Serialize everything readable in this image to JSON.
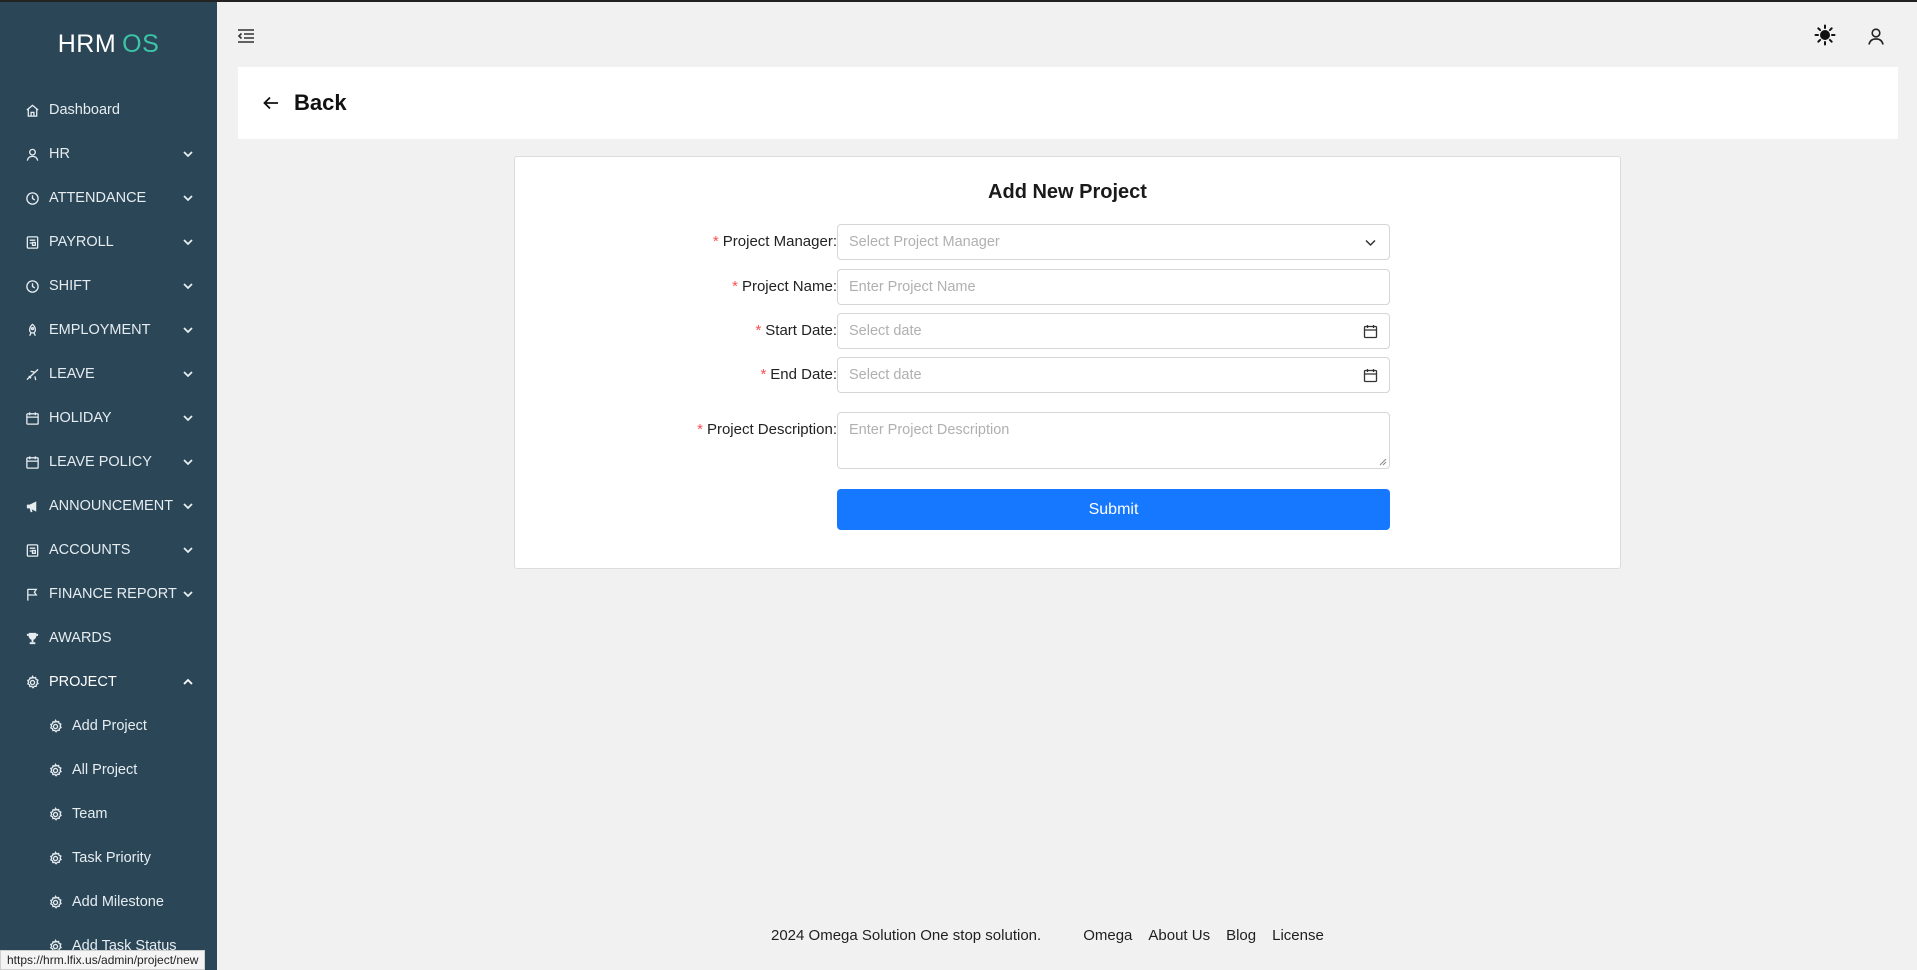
{
  "brand": {
    "name": "HRM",
    "accent": "OS",
    "accent_color": "#3cc4a6"
  },
  "sidebar": {
    "items": [
      {
        "label": "Dashboard",
        "icon": "home-icon"
      },
      {
        "label": "HR",
        "icon": "user-icon"
      },
      {
        "label": "ATTENDANCE",
        "icon": "clock-icon"
      },
      {
        "label": "PAYROLL",
        "icon": "file-icon"
      },
      {
        "label": "SHIFT",
        "icon": "clock-icon"
      },
      {
        "label": "EMPLOYMENT",
        "icon": "rocket-icon"
      },
      {
        "label": "LEAVE",
        "icon": "plane-icon"
      },
      {
        "label": "HOLIDAY",
        "icon": "calendar-icon"
      },
      {
        "label": "LEAVE POLICY",
        "icon": "calendar-icon"
      },
      {
        "label": "ANNOUNCEMENT",
        "icon": "megaphone-icon"
      },
      {
        "label": "ACCOUNTS",
        "icon": "file-icon"
      },
      {
        "label": "FINANCE REPORT",
        "icon": "flag-icon"
      },
      {
        "label": "AWARDS",
        "icon": "trophy-icon"
      },
      {
        "label": "PROJECT",
        "icon": "gear-icon"
      }
    ],
    "project_sub": [
      {
        "label": "Add Project"
      },
      {
        "label": "All Project"
      },
      {
        "label": "Team"
      },
      {
        "label": "Task Priority"
      },
      {
        "label": "Add Milestone"
      },
      {
        "label": "Add Task Status"
      }
    ]
  },
  "header": {
    "back_label": "Back"
  },
  "form": {
    "title": "Add New Project",
    "fields": {
      "manager": {
        "label": "Project Manager",
        "placeholder": "Select Project Manager"
      },
      "name": {
        "label": "Project Name",
        "placeholder": "Enter Project Name"
      },
      "start": {
        "label": "Start Date",
        "placeholder": "Select date"
      },
      "end": {
        "label": "End Date",
        "placeholder": "Select date"
      },
      "description": {
        "label": "Project Description",
        "placeholder": "Enter Project Description"
      }
    },
    "required_mark": "*",
    "colon": ":",
    "submit_label": "Submit"
  },
  "footer": {
    "copyright": "2024 Omega Solution One stop solution.",
    "links": [
      "Omega",
      "About Us",
      "Blog",
      "License"
    ]
  },
  "status_url": "https://hrm.lfix.us/admin/project/new",
  "colors": {
    "sidebar_bg": "#2b4657",
    "primary": "#1677ff",
    "required": "#ff4d4f"
  }
}
